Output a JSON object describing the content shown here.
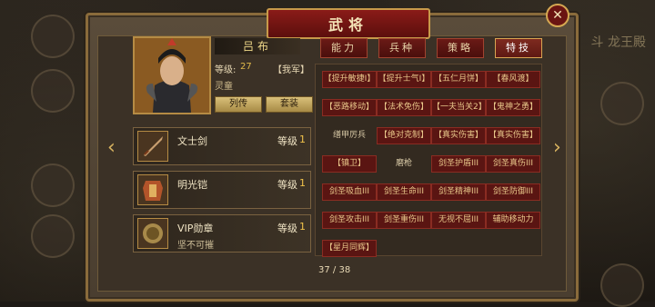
{
  "window": {
    "title": "武将",
    "close_glyph": "✕"
  },
  "background": {
    "side_text": "斗 龙王殿"
  },
  "hero": {
    "name": "吕布",
    "level_label": "等级:",
    "level_value": "27",
    "faction": "【我军】",
    "subname": "灵童",
    "buttons": [
      "列传",
      "套装"
    ]
  },
  "equipment": [
    {
      "name": "文士剑",
      "level_label": "等级",
      "level": "1",
      "desc": "",
      "icon": "sword-icon"
    },
    {
      "name": "明光铠",
      "level_label": "等级",
      "level": "1",
      "desc": "",
      "icon": "armor-icon"
    },
    {
      "name": "VIP勋章",
      "level_label": "等级",
      "level": "1",
      "desc": "坚不可摧",
      "icon": "medal-icon"
    }
  ],
  "tabs": [
    "能力",
    "兵种",
    "策略",
    "特技"
  ],
  "active_tab": "特技",
  "skills": [
    {
      "label": "【提升敏捷Ⅰ】",
      "style": "red"
    },
    {
      "label": "【提升士气Ⅰ】",
      "style": "red"
    },
    {
      "label": "【五仁月饼】",
      "style": "red"
    },
    {
      "label": "【春风渡】",
      "style": "red"
    },
    {
      "label": "【恶路移动】",
      "style": "red"
    },
    {
      "label": "【法术免伤】",
      "style": "red"
    },
    {
      "label": "【一夫当关2】",
      "style": "red"
    },
    {
      "label": "【鬼神之勇】",
      "style": "red"
    },
    {
      "label": "缮甲厉兵",
      "style": "plain"
    },
    {
      "label": "【绝对克制】",
      "style": "red"
    },
    {
      "label": "【真实伤害】",
      "style": "red"
    },
    {
      "label": "【真实伤害】",
      "style": "red"
    },
    {
      "label": "【镇卫】",
      "style": "red"
    },
    {
      "label": "磨枪",
      "style": "plain"
    },
    {
      "label": "剑圣护盾III",
      "style": "red"
    },
    {
      "label": "剑圣真伤III",
      "style": "red"
    },
    {
      "label": "剑圣吸血III",
      "style": "red"
    },
    {
      "label": "剑圣生命III",
      "style": "red"
    },
    {
      "label": "剑圣精神III",
      "style": "red"
    },
    {
      "label": "剑圣防御III",
      "style": "red"
    },
    {
      "label": "剑圣攻击III",
      "style": "red"
    },
    {
      "label": "剑圣重伤III",
      "style": "red"
    },
    {
      "label": "无视不屈III",
      "style": "red"
    },
    {
      "label": "辅助移动力",
      "style": "red"
    },
    {
      "label": "【星月同辉】",
      "style": "red"
    }
  ],
  "pagination": "37 / 38",
  "nav": {
    "left_glyph": "‹",
    "right_glyph": "›"
  }
}
